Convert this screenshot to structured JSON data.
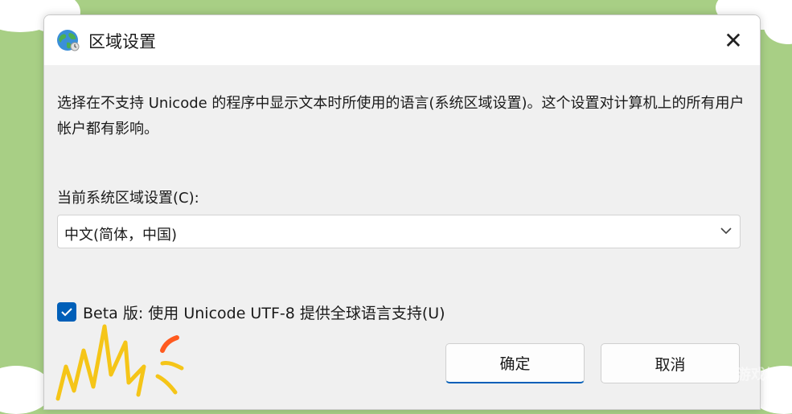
{
  "dialog": {
    "title": "区域设置",
    "title_icon": "globe-icon",
    "close_icon": "close-icon",
    "close_glyph": "✕",
    "description": "选择在不支持 Unicode 的程序中显示文本时所使用的语言(系统区域设置)。这个设置对计算机上的所有用户帐户都有影响。",
    "locale_label": "当前系统区域设置(C):",
    "locale_value": "中文(简体，中国)",
    "beta_checkbox_checked": true,
    "beta_label": "Beta 版: 使用 Unicode UTF-8 提供全球语言支持(U)",
    "ok_label": "确定",
    "cancel_label": "取消"
  },
  "watermark": "游戏坊",
  "colors": {
    "background": "#a8cf85",
    "accent": "#005fb8",
    "dialog_bg": "#f0f0f0",
    "doodle_yellow": "#f5c518",
    "doodle_orange": "#ff5a1f"
  }
}
